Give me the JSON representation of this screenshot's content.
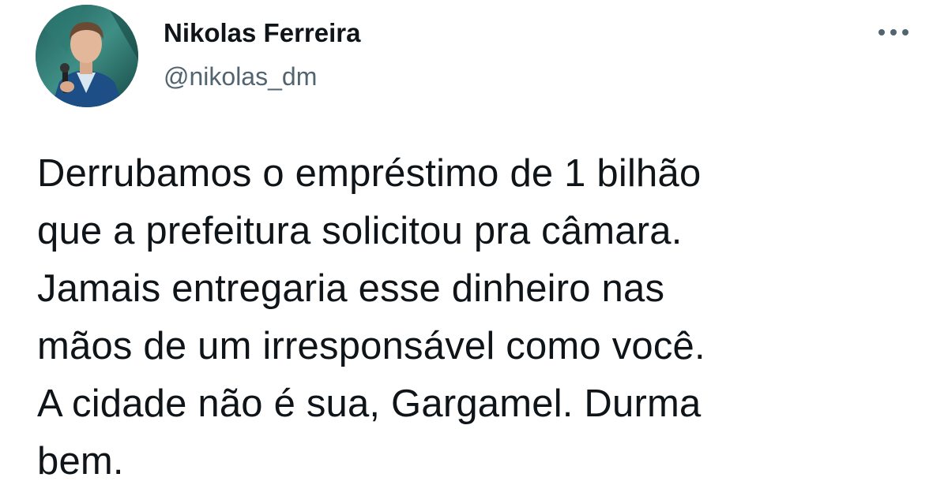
{
  "author": {
    "display_name": "Nikolas Ferreira",
    "handle": "@nikolas_dm",
    "avatar_icon": "profile-photo"
  },
  "menu": {
    "more_icon": "more-horizontal-icon"
  },
  "tweet": {
    "lines": [
      "Derrubamos o empréstimo de 1 bilhão",
      "que a prefeitura solicitou pra câmara.",
      "Jamais entregaria esse dinheiro nas",
      "mãos de um irresponsável como você.",
      "A cidade não é sua, Gargamel. Durma",
      "bem."
    ]
  },
  "colors": {
    "text_primary": "#0f1419",
    "text_secondary": "#536471",
    "background": "#ffffff"
  }
}
